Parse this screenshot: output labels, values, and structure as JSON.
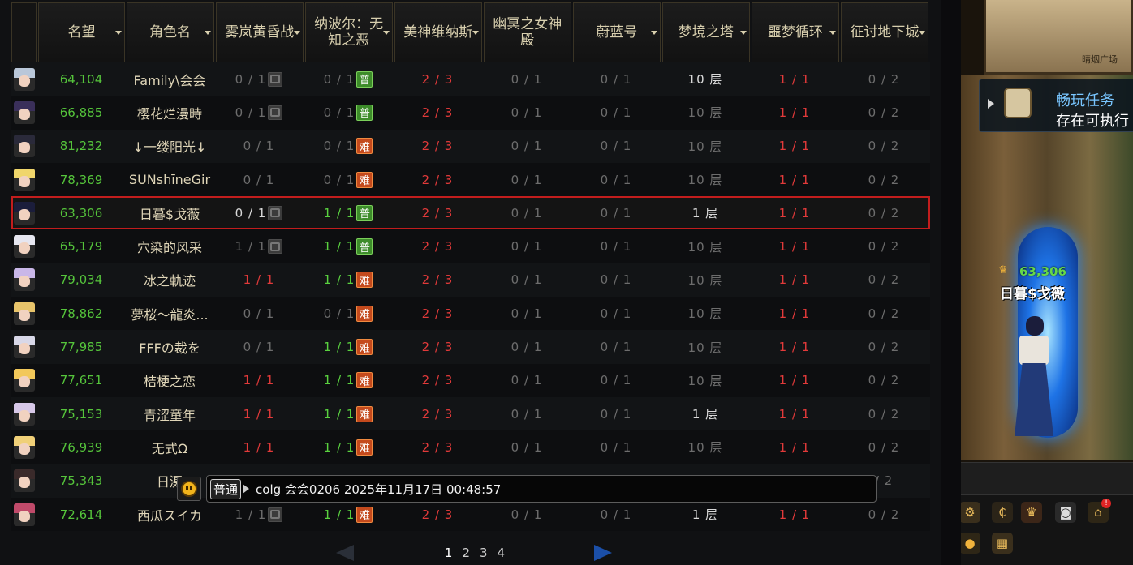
{
  "table": {
    "headers": [
      {
        "label": "",
        "sortable": false
      },
      {
        "label": "名望",
        "sortable": true
      },
      {
        "label": "角色名",
        "sortable": true
      },
      {
        "label": "雾岚黄昏战",
        "sortable": true
      },
      {
        "label": "纳波尔：无知之恶",
        "sortable": true
      },
      {
        "label": "美神维纳斯",
        "sortable": true
      },
      {
        "label": "幽冥之女神殿",
        "sortable": false
      },
      {
        "label": "蔚蓝号",
        "sortable": true
      },
      {
        "label": "梦境之塔",
        "sortable": true
      },
      {
        "label": "噩梦循环",
        "sortable": true
      },
      {
        "label": "征讨地下城",
        "sortable": true
      }
    ],
    "rows": [
      {
        "avatar_color": "#b9c7d9",
        "fame": "64,104",
        "name": "Family\\会会",
        "wu": "0 / 1",
        "wu_badge": "lock",
        "na": "0 / 1",
        "na_badge": "普",
        "na_badge_type": "pu",
        "venus": "2 / 3",
        "yx": "0 / 1",
        "wl": "0 / 1",
        "tower": "10 层",
        "nightmare": "1 / 1",
        "dungeon": "0 / 2",
        "state": {
          "wu": "grey",
          "na": "grey",
          "tower": "white"
        }
      },
      {
        "avatar_color": "#3a2f5a",
        "fame": "66,885",
        "name": "樱花烂漫時",
        "wu": "0 / 1",
        "wu_badge": "lock",
        "na": "0 / 1",
        "na_badge": "普",
        "na_badge_type": "pu",
        "venus": "2 / 3",
        "yx": "0 / 1",
        "wl": "0 / 1",
        "tower": "10 层",
        "nightmare": "1 / 1",
        "dungeon": "0 / 2",
        "state": {
          "wu": "grey",
          "na": "grey",
          "tower": "grey"
        }
      },
      {
        "avatar_color": "#2a2a3a",
        "fame": "81,232",
        "name": "↓一缕阳光↓",
        "wu": "0 / 1",
        "wu_badge": "",
        "na": "0 / 1",
        "na_badge": "难",
        "na_badge_type": "nan",
        "venus": "2 / 3",
        "yx": "0 / 1",
        "wl": "0 / 1",
        "tower": "10 层",
        "nightmare": "1 / 1",
        "dungeon": "0 / 2",
        "state": {
          "wu": "grey",
          "na": "grey",
          "tower": "grey"
        }
      },
      {
        "avatar_color": "#f0d66b",
        "fame": "78,369",
        "name": "SUNshīneGir",
        "wu": "0 / 1",
        "wu_badge": "",
        "na": "0 / 1",
        "na_badge": "难",
        "na_badge_type": "nan",
        "venus": "2 / 3",
        "yx": "0 / 1",
        "wl": "0 / 1",
        "tower": "10 层",
        "nightmare": "1 / 1",
        "dungeon": "0 / 2",
        "state": {
          "wu": "grey",
          "na": "grey",
          "tower": "grey"
        }
      },
      {
        "avatar_color": "#1b1d3b",
        "fame": "63,306",
        "name": "日暮$戈薇",
        "wu": "0 / 1",
        "wu_badge": "lock",
        "na": "1 / 1",
        "na_badge": "普",
        "na_badge_type": "pu",
        "venus": "2 / 3",
        "yx": "0 / 1",
        "wl": "0 / 1",
        "tower": "1 层",
        "nightmare": "1 / 1",
        "dungeon": "0 / 2",
        "selected": true,
        "state": {
          "wu": "white",
          "na": "green",
          "tower": "white"
        }
      },
      {
        "avatar_color": "#e6e6f0",
        "fame": "65,179",
        "name": "穴染的风采",
        "wu": "1 / 1",
        "wu_badge": "lock",
        "na": "1 / 1",
        "na_badge": "普",
        "na_badge_type": "pu",
        "venus": "2 / 3",
        "yx": "0 / 1",
        "wl": "0 / 1",
        "tower": "10 层",
        "nightmare": "1 / 1",
        "dungeon": "0 / 2",
        "state": {
          "wu": "grey",
          "na": "green",
          "tower": "grey"
        }
      },
      {
        "avatar_color": "#c9b7e8",
        "fame": "79,034",
        "name": "冰之軌迹",
        "wu": "1 / 1",
        "wu_badge": "",
        "na": "1 / 1",
        "na_badge": "难",
        "na_badge_type": "nan",
        "venus": "2 / 3",
        "yx": "0 / 1",
        "wl": "0 / 1",
        "tower": "10 层",
        "nightmare": "1 / 1",
        "dungeon": "0 / 2",
        "state": {
          "wu": "red",
          "na": "green",
          "tower": "grey"
        }
      },
      {
        "avatar_color": "#e8c46a",
        "fame": "78,862",
        "name": "夢桜～龍炎...",
        "wu": "0 / 1",
        "wu_badge": "",
        "na": "0 / 1",
        "na_badge": "难",
        "na_badge_type": "nan",
        "venus": "2 / 3",
        "yx": "0 / 1",
        "wl": "0 / 1",
        "tower": "10 层",
        "nightmare": "1 / 1",
        "dungeon": "0 / 2",
        "state": {
          "wu": "grey",
          "na": "grey",
          "tower": "grey"
        }
      },
      {
        "avatar_color": "#d8d8e8",
        "fame": "77,985",
        "name": "FFFの裁を",
        "wu": "0 / 1",
        "wu_badge": "",
        "na": "1 / 1",
        "na_badge": "难",
        "na_badge_type": "nan",
        "venus": "2 / 3",
        "yx": "0 / 1",
        "wl": "0 / 1",
        "tower": "10 层",
        "nightmare": "1 / 1",
        "dungeon": "0 / 2",
        "state": {
          "wu": "grey",
          "na": "green",
          "tower": "grey"
        }
      },
      {
        "avatar_color": "#f2c85a",
        "fame": "77,651",
        "name": "桔梗之恋",
        "wu": "1 / 1",
        "wu_badge": "",
        "na": "1 / 1",
        "na_badge": "难",
        "na_badge_type": "nan",
        "venus": "2 / 3",
        "yx": "0 / 1",
        "wl": "0 / 1",
        "tower": "10 层",
        "nightmare": "1 / 1",
        "dungeon": "0 / 2",
        "state": {
          "wu": "red",
          "na": "green",
          "tower": "grey"
        }
      },
      {
        "avatar_color": "#d7c8e8",
        "fame": "75,153",
        "name": "青涩童年",
        "wu": "1 / 1",
        "wu_badge": "",
        "na": "1 / 1",
        "na_badge": "难",
        "na_badge_type": "nan",
        "venus": "2 / 3",
        "yx": "0 / 1",
        "wl": "0 / 1",
        "tower": "1 层",
        "nightmare": "1 / 1",
        "dungeon": "0 / 2",
        "state": {
          "wu": "red",
          "na": "green",
          "tower": "white"
        }
      },
      {
        "avatar_color": "#f0d078",
        "fame": "76,939",
        "name": "无式Ω",
        "wu": "1 / 1",
        "wu_badge": "",
        "na": "1 / 1",
        "na_badge": "难",
        "na_badge_type": "nan",
        "venus": "2 / 3",
        "yx": "0 / 1",
        "wl": "0 / 1",
        "tower": "10 层",
        "nightmare": "1 / 1",
        "dungeon": "0 / 2",
        "state": {
          "wu": "red",
          "na": "green",
          "tower": "grey"
        }
      },
      {
        "avatar_color": "#3a2a2a",
        "fame": "75,343",
        "name": "日滠",
        "wu": "",
        "wu_badge": "",
        "na": "",
        "na_badge": "",
        "na_badge_type": "",
        "venus": "",
        "yx": "",
        "wl": "",
        "tower": "",
        "nightmare": "",
        "dungeon": "/ 2",
        "state": {
          "wu": "grey",
          "na": "grey",
          "tower": "grey"
        }
      },
      {
        "avatar_color": "#c04a6a",
        "fame": "72,614",
        "name": "西瓜スイカ",
        "wu": "1 / 1",
        "wu_badge": "lock",
        "na": "1 / 1",
        "na_badge": "难",
        "na_badge_type": "nan",
        "venus": "2 / 3",
        "yx": "0 / 1",
        "wl": "0 / 1",
        "tower": "1 层",
        "nightmare": "1 / 1",
        "dungeon": "0 / 2",
        "state": {
          "wu": "grey",
          "na": "green",
          "tower": "white"
        }
      }
    ]
  },
  "chat": {
    "channel": "普通",
    "message": "colg 会会0206 2025年11月17日 00:48:57"
  },
  "pagination": {
    "pages": [
      "1",
      "2",
      "3",
      "4"
    ],
    "current": "1"
  },
  "scene": {
    "minimap_label": "晴烟广场",
    "quest_title": "畅玩任务",
    "quest_desc": "存在可执行",
    "hero_fame": "63,306",
    "hero_name": "日暮$戈薇",
    "icons": [
      "gear-icon",
      "coin-icon",
      "crown-icon",
      "camera-icon",
      "home-icon",
      "map-pin-icon",
      "menu-icon"
    ],
    "notification_count": "!"
  },
  "colors": {
    "fame_green": "#55c43b",
    "selected_border": "#c21d1d",
    "accent_red": "#e23a3a",
    "done_green": "#59d13f"
  }
}
